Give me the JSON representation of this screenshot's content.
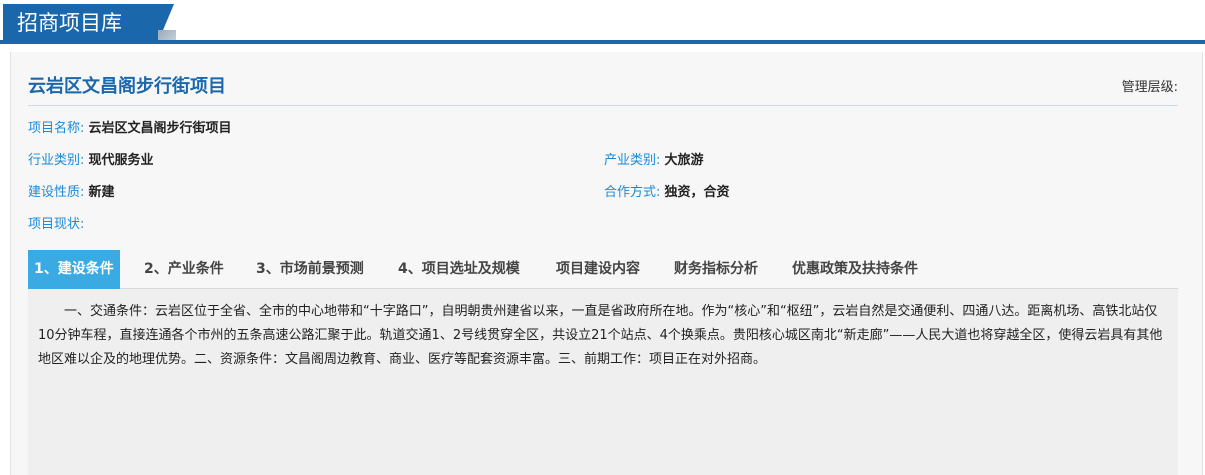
{
  "header": {
    "tab_title": "招商项目库"
  },
  "project": {
    "title": "云岩区文昌阁步行街项目",
    "management_level_label": "管理层级:",
    "fields": {
      "name": {
        "label": "项目名称:",
        "value": "云岩区文昌阁步行街项目"
      },
      "industry": {
        "label": "行业类别:",
        "value": "现代服务业"
      },
      "sector": {
        "label": "产业类别:",
        "value": "大旅游"
      },
      "construction": {
        "label": "建设性质:",
        "value": "新建"
      },
      "cooperation": {
        "label": "合作方式:",
        "value": "独资，合资"
      },
      "status": {
        "label": "项目现状:",
        "value": ""
      }
    }
  },
  "tabs": [
    {
      "label": "1、建设条件",
      "active": true
    },
    {
      "label": "2、产业条件"
    },
    {
      "label": "3、市场前景预测"
    },
    {
      "label": "4、项目选址及规模"
    },
    {
      "label": "项目建设内容"
    },
    {
      "label": "财务指标分析"
    },
    {
      "label": "优惠政策及扶持条件"
    }
  ],
  "content": {
    "text": "一、交通条件：云岩区位于全省、全市的中心地带和“十字路口”，自明朝贵州建省以来，一直是省政府所在地。作为“核心”和“枢纽”，云岩自然是交通便利、四通八达。距离机场、高铁北站仅10分钟车程，直接连通各个市州的五条高速公路汇聚于此。轨道交通1、2号线贯穿全区，共设立21个站点、4个换乘点。贵阳核心城区南北“新走廊”——人民大道也将穿越全区，使得云岩具有其他地区难以企及的地理优势。二、资源条件：文昌阁周边教育、商业、医疗等配套资源丰富。三、前期工作：项目正在对外招商。"
  },
  "colors": {
    "brand": "#1b67ab",
    "label": "#1a8ad6",
    "active_tab": "#3aaae3"
  }
}
